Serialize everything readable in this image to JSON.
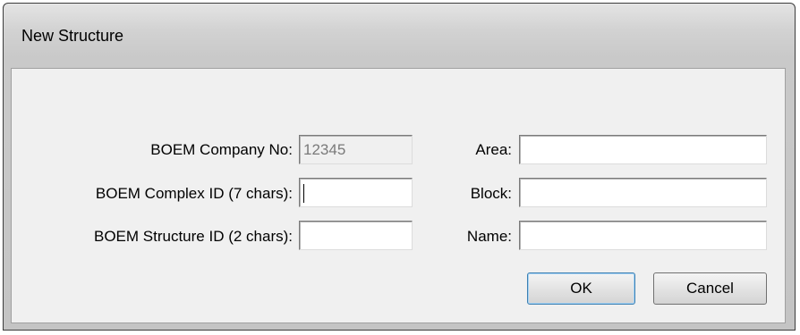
{
  "window": {
    "title": "New Structure"
  },
  "form": {
    "company_no_label": "BOEM Company No:",
    "company_no_value": "12345",
    "complex_id_label": "BOEM Complex ID (7 chars):",
    "complex_id_value": "",
    "structure_id_label": "BOEM Structure ID (2 chars):",
    "structure_id_value": "",
    "area_label": "Area:",
    "area_value": "",
    "block_label": "Block:",
    "block_value": "",
    "name_label": "Name:",
    "name_value": ""
  },
  "buttons": {
    "ok_label": "OK",
    "cancel_label": "Cancel"
  }
}
